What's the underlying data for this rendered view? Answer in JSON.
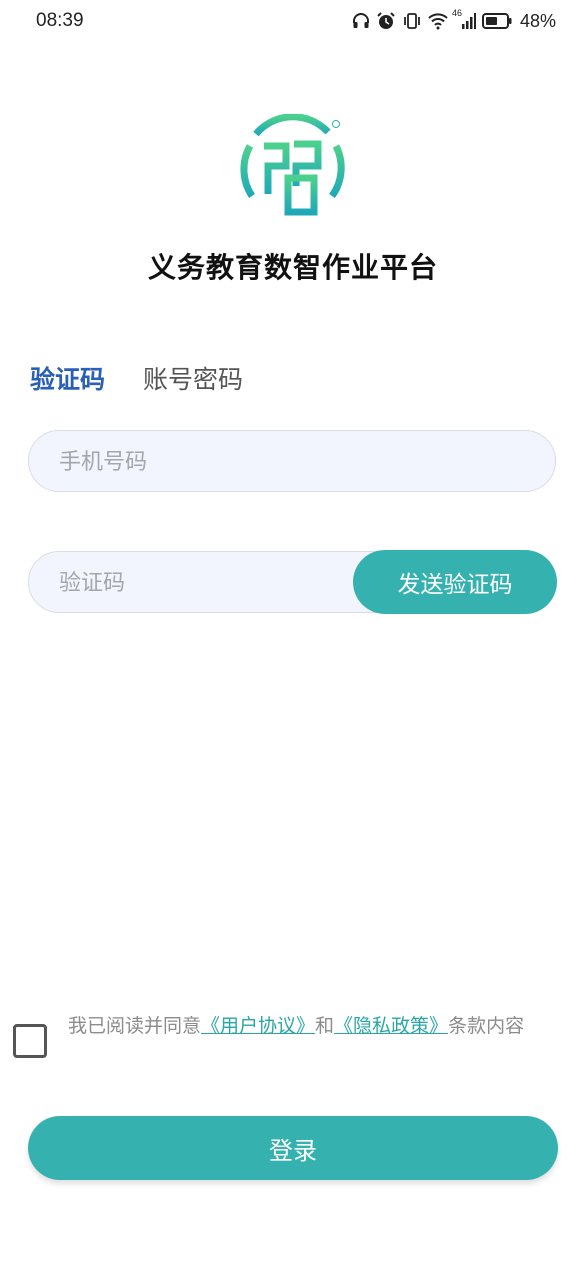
{
  "status_bar": {
    "time": "08:39",
    "battery_percent": "48%",
    "network_label": "46",
    "icons": [
      "headphones-icon",
      "alarm-icon",
      "vibrate-icon",
      "wifi-icon",
      "signal-icon",
      "battery-icon"
    ]
  },
  "app": {
    "title": "义务教育数智作业平台",
    "logo_icon": "app-logo-icon",
    "logo_mark": "®"
  },
  "tabs": [
    {
      "label": "验证码",
      "active": true
    },
    {
      "label": "账号密码",
      "active": false
    }
  ],
  "form": {
    "phone_placeholder": "手机号码",
    "code_placeholder": "验证码",
    "send_code_label": "发送验证码"
  },
  "agreement": {
    "prefix": "我已阅读并同意",
    "user_agreement": "《用户协议》",
    "and": "和",
    "privacy_policy": "《隐私政策》",
    "suffix": "条款内容",
    "checked": false
  },
  "login_label": "登录",
  "colors": {
    "accent": "#35b1b0",
    "active_tab": "#2a5fb8",
    "input_bg": "#f2f5fd",
    "link": "#2aa7a5"
  }
}
